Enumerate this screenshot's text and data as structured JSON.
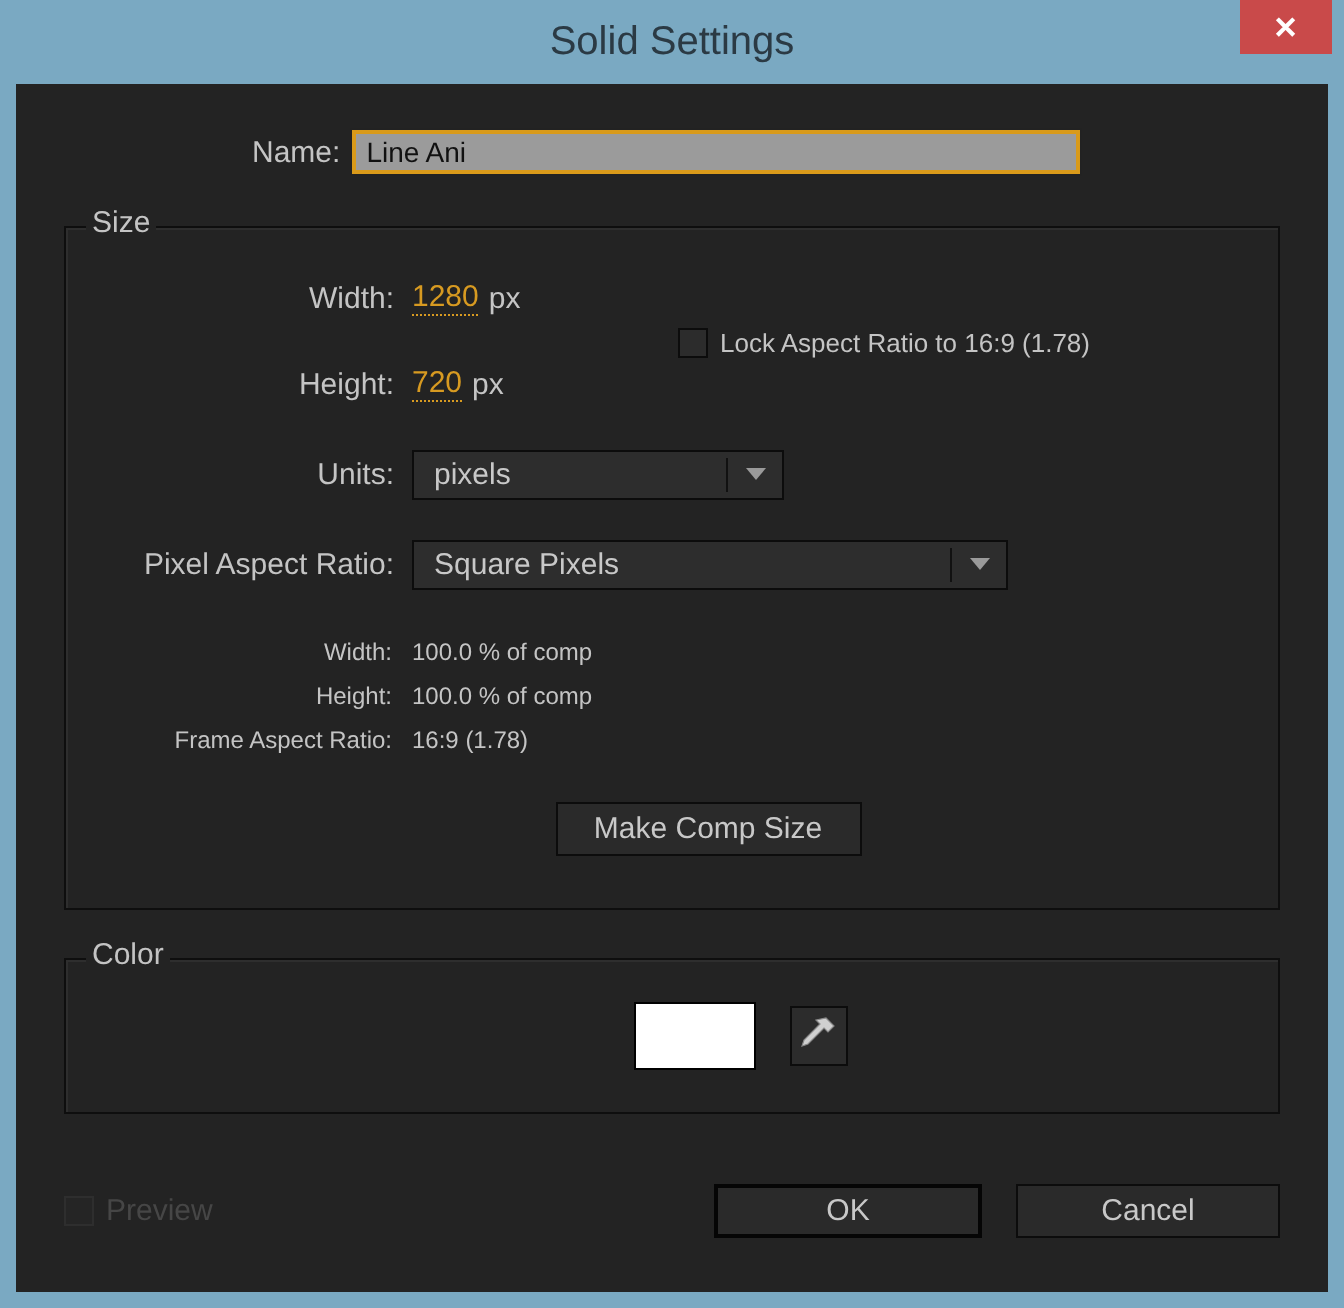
{
  "window": {
    "title": "Solid Settings",
    "close": "✕"
  },
  "name": {
    "label": "Name:",
    "value": "Line Ani",
    "focused": true
  },
  "size": {
    "title": "Size",
    "width": {
      "label": "Width:",
      "value": "1280",
      "unit": "px"
    },
    "height": {
      "label": "Height:",
      "value": "720",
      "unit": "px"
    },
    "lock": {
      "label": "Lock Aspect Ratio to 16:9 (1.78)",
      "checked": false
    },
    "units": {
      "label": "Units:",
      "value": "pixels"
    },
    "pixel_aspect": {
      "label": "Pixel Aspect Ratio:",
      "value": "Square Pixels"
    },
    "info": [
      {
        "label": "Width:",
        "value": "100.0 % of comp"
      },
      {
        "label": "Height:",
        "value": "100.0 % of comp"
      },
      {
        "label": "Frame Aspect Ratio:",
        "value": "16:9 (1.78)"
      }
    ],
    "button": "Make Comp Size"
  },
  "color": {
    "title": "Color",
    "swatch": {
      "color": "#ffffff"
    }
  },
  "preview": {
    "label": "Preview",
    "checked": false,
    "disabled": true
  },
  "buttons": [
    {
      "label": "OK",
      "default": true
    },
    {
      "label": "Cancel",
      "default": false
    }
  ]
}
